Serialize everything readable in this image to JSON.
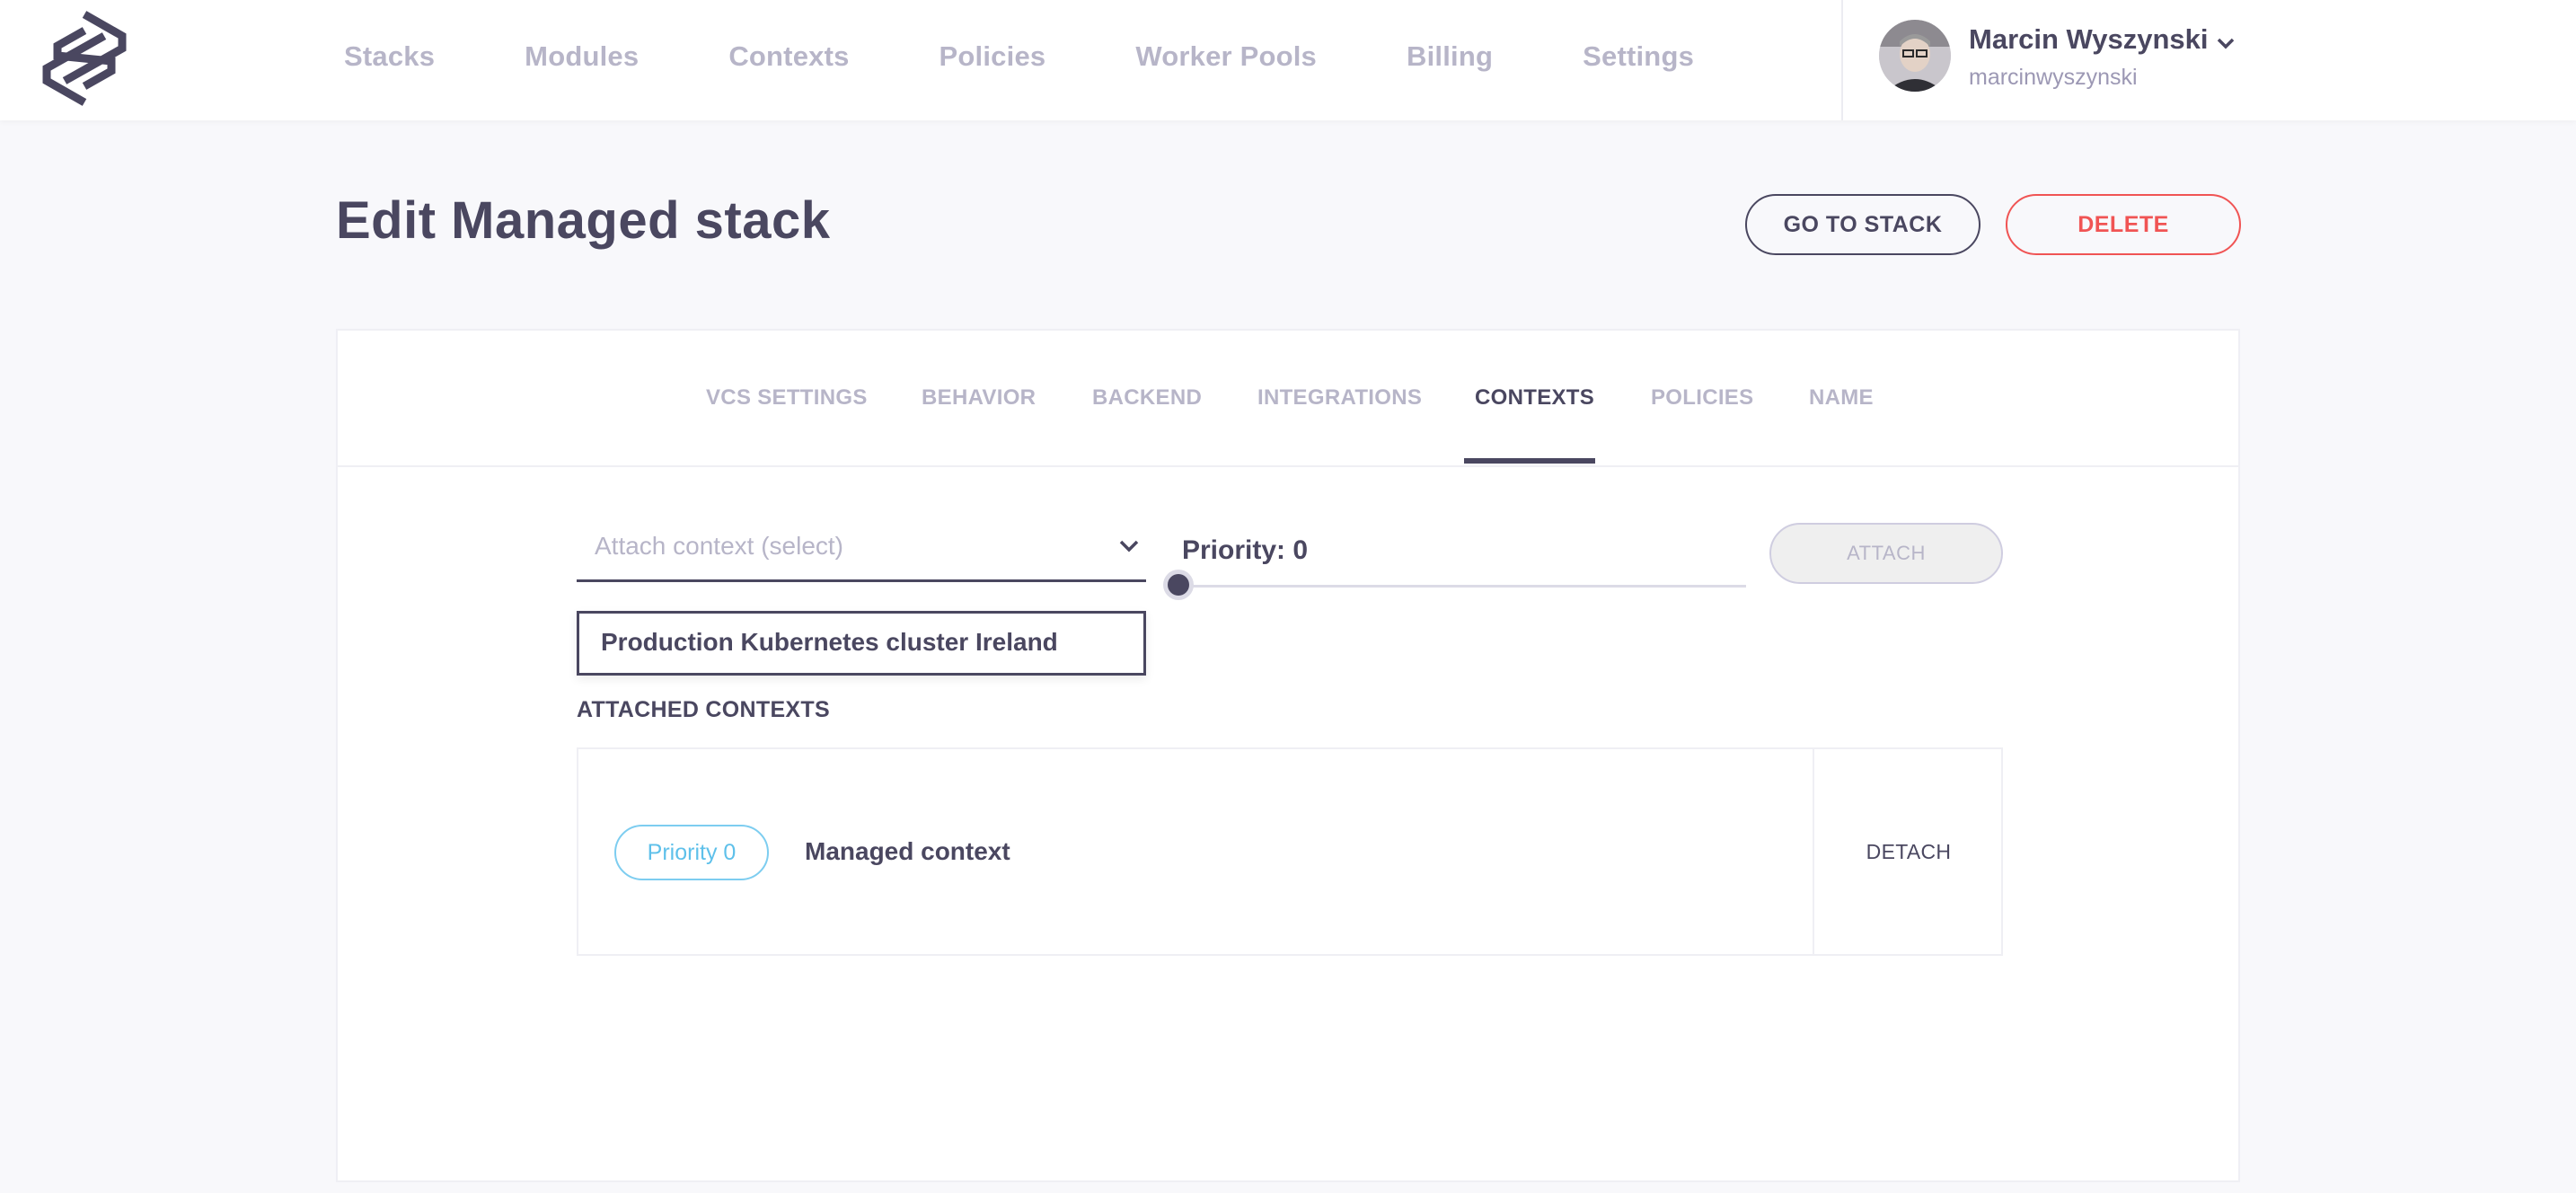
{
  "nav": {
    "items": [
      "Stacks",
      "Modules",
      "Contexts",
      "Policies",
      "Worker Pools",
      "Billing",
      "Settings"
    ]
  },
  "user": {
    "name": "Marcin Wyszynski",
    "handle": "marcinwyszynski"
  },
  "page": {
    "title": "Edit Managed stack",
    "go_to_stack_label": "GO TO STACK",
    "delete_label": "DELETE"
  },
  "tabs": [
    {
      "label": "VCS SETTINGS",
      "active": false
    },
    {
      "label": "BEHAVIOR",
      "active": false
    },
    {
      "label": "BACKEND",
      "active": false
    },
    {
      "label": "INTEGRATIONS",
      "active": false
    },
    {
      "label": "CONTEXTS",
      "active": true
    },
    {
      "label": "POLICIES",
      "active": false
    },
    {
      "label": "NAME",
      "active": false
    }
  ],
  "attach": {
    "select_placeholder": "Attach context (select)",
    "dropdown_options": [
      "Production Kubernetes cluster Ireland"
    ],
    "priority_label": "Priority: 0",
    "priority_value": 0,
    "attach_label": "ATTACH"
  },
  "attached": {
    "section_label": "ATTACHED CONTEXTS",
    "items": [
      {
        "priority_badge": "Priority 0",
        "name": "Managed context",
        "detach_label": "DETACH"
      }
    ]
  },
  "colors": {
    "text": "#4a4760",
    "muted": "#b7b5c8",
    "danger": "#f05454",
    "badge": "#5ec0ea",
    "background": "#f8f8fb"
  }
}
